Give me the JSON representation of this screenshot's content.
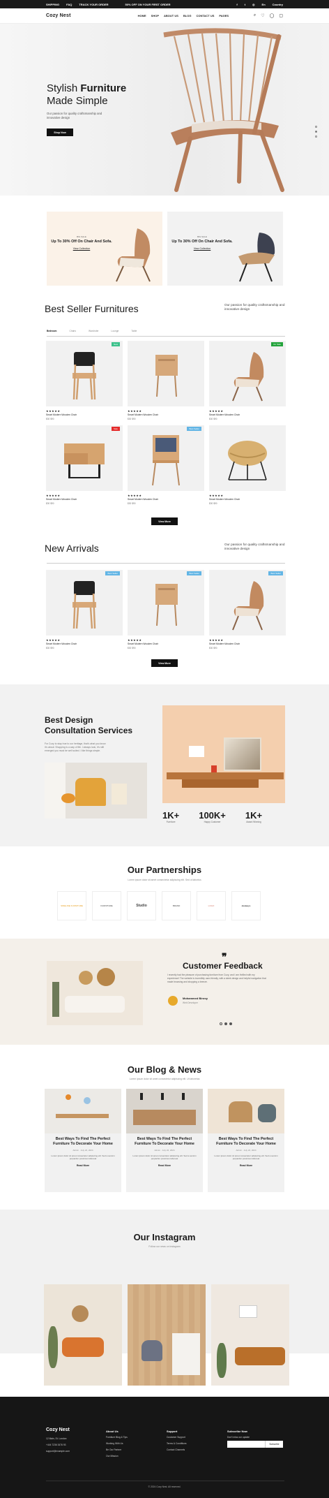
{
  "topbar": {
    "shipping": "SHIPPING",
    "faq": "FAQ",
    "track": "TRACK YOUR ORDER",
    "promo": "50% OFF ON YOUR FIRST ORDER",
    "lang": "En",
    "country": "Country"
  },
  "brand": {
    "logo": "Cozy Nest"
  },
  "nav": {
    "items": [
      "HOME",
      "SHOP",
      "ABOUT US",
      "BLOG",
      "CONTACT US",
      "PAGES"
    ]
  },
  "hero": {
    "title_1": "Stylish ",
    "title_bold": "Furniture",
    "title_2": "Made Simple",
    "desc": "Our passion for quality craftsmanship and innovative design",
    "cta": "Shop Now"
  },
  "offers": [
    {
      "small": "BIG SALE",
      "headline": "Up To 30% Off On Chair And Sofa.",
      "link": "View Collection"
    },
    {
      "small": "BIG SALE",
      "headline": "Up To 30% Off On Chair And Sofa.",
      "link": "View Collection"
    }
  ],
  "bestseller": {
    "title": "Best Seller Furnitures",
    "sub": "Our passion for quality craftsmanship and innovative design",
    "tabs": [
      "Bedroom",
      "Chairs",
      "Wardrobe",
      "Lounge",
      "Table"
    ],
    "button": "View More",
    "products": [
      {
        "badge": "New",
        "name": "Smart Modern Wooden Chair",
        "price": "$30 $90"
      },
      {
        "badge": "",
        "name": "Smart Modern Wooden Chair",
        "price": "$30 $90"
      },
      {
        "badge": "On Sale",
        "name": "Smart Modern Wooden Chair",
        "price": "$30 $90"
      },
      {
        "badge": "Sale",
        "name": "Smart Modern Wooden Chair",
        "price": "$30 $90"
      },
      {
        "badge": "Best Seller",
        "name": "Smart Modern Wooden Chair",
        "price": "$30 $90"
      },
      {
        "badge": "",
        "name": "Smart Modern Wooden Chair",
        "price": "$30 $90"
      }
    ]
  },
  "arrivals": {
    "title": "New Arrivals",
    "sub": "Our passion for quality craftsmanship and innovative design",
    "button": "View More",
    "products": [
      {
        "badge": "Best Seller",
        "name": "Smart Modern Wooden Chair",
        "price": "$30 $90"
      },
      {
        "badge": "Best Seller",
        "name": "Smart Modern Wooden Chair",
        "price": "$30 $90"
      },
      {
        "badge": "Best Seller",
        "name": "Smart Modern Wooden Chair",
        "price": "$30 $90"
      }
    ]
  },
  "consult": {
    "title": "Best Design Consultation Services",
    "desc": "For Cozy to stay true to our heritage, that's what you know it's about: Shopping is a way of life. I always look, it's still emerged you must be well suited. I like things simple.",
    "stats": [
      {
        "n": "1K+",
        "c": "Furniture"
      },
      {
        "n": "100K+",
        "c": "Happy Customer"
      },
      {
        "n": "1K+",
        "c": "Award Winning"
      }
    ]
  },
  "partners": {
    "title": "Our Partnerships",
    "sub": "Lorem ipsum dolor sit amet consectetur adipiscing elit. Sed ut labortus",
    "logos": [
      "SIDELINE FURNITURE",
      "FURNITURE",
      "Studio",
      "BRAND",
      "LOGO",
      "dealpays"
    ]
  },
  "feedback": {
    "title": "Customer Feedback",
    "quote": "I recently had the pleasure of purchasing furniture from Cozy, and I am thrilled with my experience! The website is incredibly user-friendly, with a sleek design and helpful navigation that made browsing and shopping a breeze.",
    "name": "Mohammed Binroy",
    "role": "Web Developer"
  },
  "blog": {
    "title": "Our Blog & News",
    "sub": "Lorem ipsum dolor sit amet consectetur adipiscing elit. Ut laboretas",
    "posts": [
      {
        "title": "Best Ways To Find The Perfect Furniture To Decorate Your Home",
        "meta": "Admin  ·  July 22, 2024",
        "excerpt": "Lorem ipsum dolor sit amet consectetur adipiscing elit. Sed a sensim perpacitur possimus laboreat",
        "link": "Read More"
      },
      {
        "title": "Best Ways To Find The Perfect Furniture To Decorate Your Home",
        "meta": "Admin  ·  July 22, 2024",
        "excerpt": "Lorem ipsum dolor sit amet consectetur adipiscing elit. Sed a sensim perpacitur possimus laboreat",
        "link": "Read More"
      },
      {
        "title": "Best Ways To Find The Perfect Furniture To Decorate Your Home",
        "meta": "Admin  ·  July 22, 2024",
        "excerpt": "Lorem ipsum dolor sit amet consectetur adipiscing elit. Sed a sensim perpacitur possimus laboreat",
        "link": "Read More"
      }
    ]
  },
  "instagram": {
    "title": "Our Instagram",
    "sub": "Follow our news on Instagram"
  },
  "footer": {
    "logo": "Cozy Nest",
    "address": "12 Main, St. London",
    "phone": "+444 7236 3476 93",
    "email": "support@example.com",
    "about_title": "About Us",
    "about": [
      "Furniture Blog & Tips",
      "Working With Us",
      "Be Our Partner",
      "Our Mission"
    ],
    "support_title": "Support",
    "support": [
      "Customer Support",
      "Terms & Conditions",
      "Contact Channels"
    ],
    "subscribe_title": "Subscribe Now",
    "subscribe_sub": "Don't miss our update",
    "email_placeholder": "",
    "subscribe_btn": "Subscribe",
    "copyright": "© 2024 Cozy Nest. All reserved."
  }
}
